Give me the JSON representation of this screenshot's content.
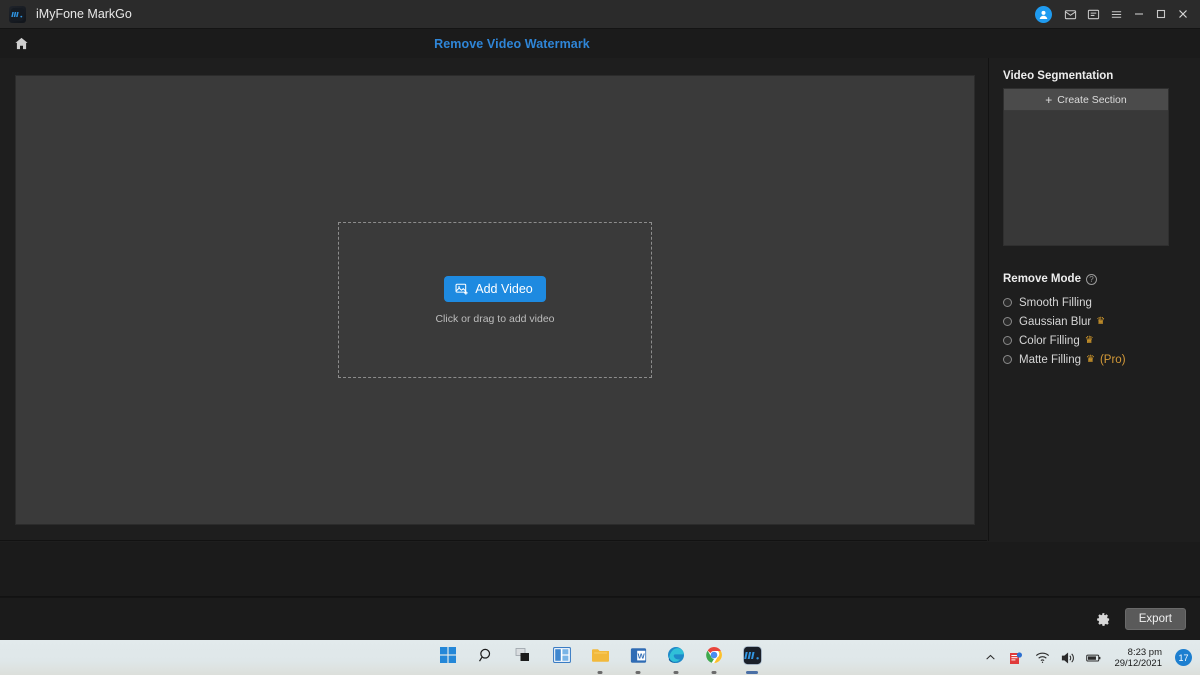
{
  "window": {
    "app_name": "iMyFone MarkGo",
    "app_icon": "markgo-app-icon",
    "controls": {
      "account": "account-avatar-icon",
      "mail": "mail-icon",
      "feedback": "feedback-icon",
      "menu": "hamburger-menu-icon",
      "minimize": "minimize-icon",
      "maximize": "maximize-icon",
      "close": "close-icon"
    }
  },
  "navbar": {
    "home_icon": "home-icon",
    "page_title": "Remove Video Watermark"
  },
  "stage": {
    "dropzone": {
      "button_label": "Add Video",
      "button_icon": "add-image-icon",
      "hint": "Click or drag to add video"
    }
  },
  "sidebar": {
    "segmentation": {
      "heading": "Video Segmentation",
      "create_label": "Create Section",
      "create_plus": "+"
    },
    "remove_mode": {
      "heading": "Remove Mode",
      "help_glyph": "?",
      "options": [
        {
          "label": "Smooth Filling",
          "pro": false,
          "crown": false,
          "selected": false
        },
        {
          "label": "Gaussian Blur",
          "pro": false,
          "crown": true,
          "selected": false
        },
        {
          "label": "Color Filling",
          "pro": false,
          "crown": true,
          "selected": false
        },
        {
          "label": "Matte Filling",
          "pro": true,
          "crown": true,
          "pro_text": "(Pro)",
          "selected": false
        }
      ]
    }
  },
  "bottombar": {
    "settings_icon": "gear-icon",
    "export_label": "Export"
  },
  "taskbar": {
    "items": [
      {
        "name": "start-button",
        "icon": "windows-logo-icon"
      },
      {
        "name": "search-button",
        "icon": "search-icon"
      },
      {
        "name": "task-view-button",
        "icon": "task-view-icon"
      },
      {
        "name": "widgets-button",
        "icon": "widgets-icon"
      },
      {
        "name": "file-explorer-button",
        "icon": "folder-icon"
      },
      {
        "name": "word-button",
        "icon": "word-icon"
      },
      {
        "name": "edge-button",
        "icon": "edge-icon"
      },
      {
        "name": "chrome-button",
        "icon": "chrome-icon"
      },
      {
        "name": "markgo-button",
        "icon": "markgo-app-icon"
      }
    ],
    "tray": {
      "overflow_icon": "chevron-up-icon",
      "app_icon": "tray-app-icon",
      "network_icon": "wifi-icon",
      "volume_icon": "speaker-icon",
      "battery_icon": "battery-icon",
      "time": "8:23 pm",
      "date": "29/12/2021",
      "notification_count": "17"
    }
  },
  "colors": {
    "accent_blue": "#1e8ae0",
    "title_blue": "#2f86d8",
    "crown_gold": "#e0a22c",
    "pro_orange": "#d49a38",
    "panel_bg": "#383838",
    "preview_bg": "#3a3a3a",
    "app_bg": "#1e1e1e"
  }
}
